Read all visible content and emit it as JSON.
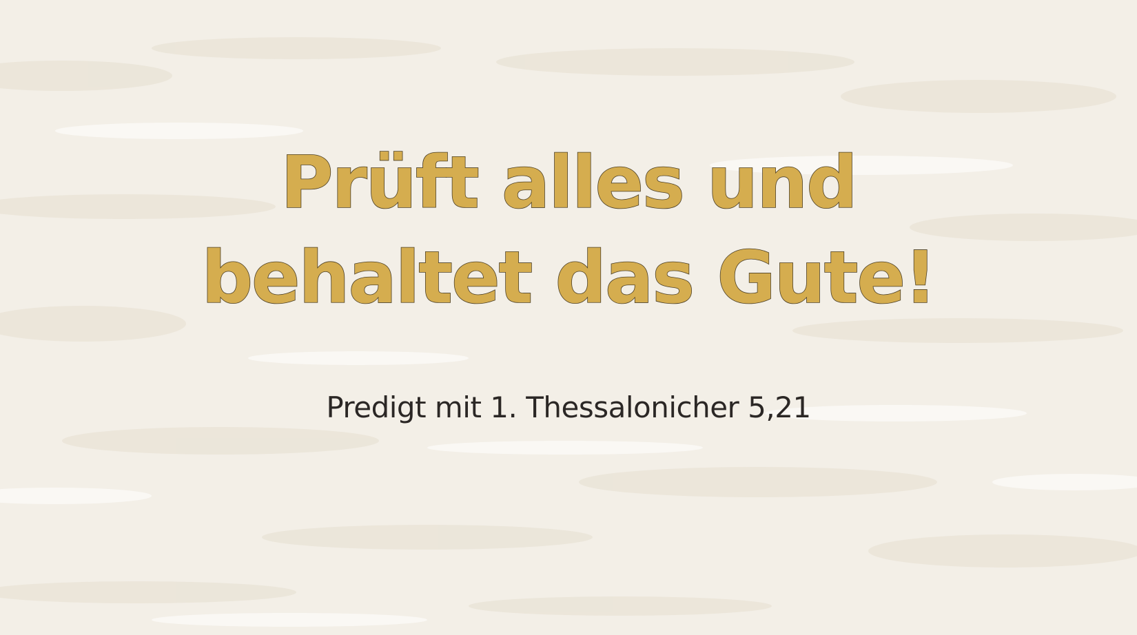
{
  "slide": {
    "title_line1": "Prüft alles und",
    "title_line2": "behaltet das Gute!",
    "subtitle": "Predigt mit 1. Thessalonicher 5,21"
  },
  "colors": {
    "background": "#f3efe7",
    "title_fill": "#d5ad4f",
    "title_outline": "#4a3e26",
    "subtitle_text": "#2b2725"
  }
}
